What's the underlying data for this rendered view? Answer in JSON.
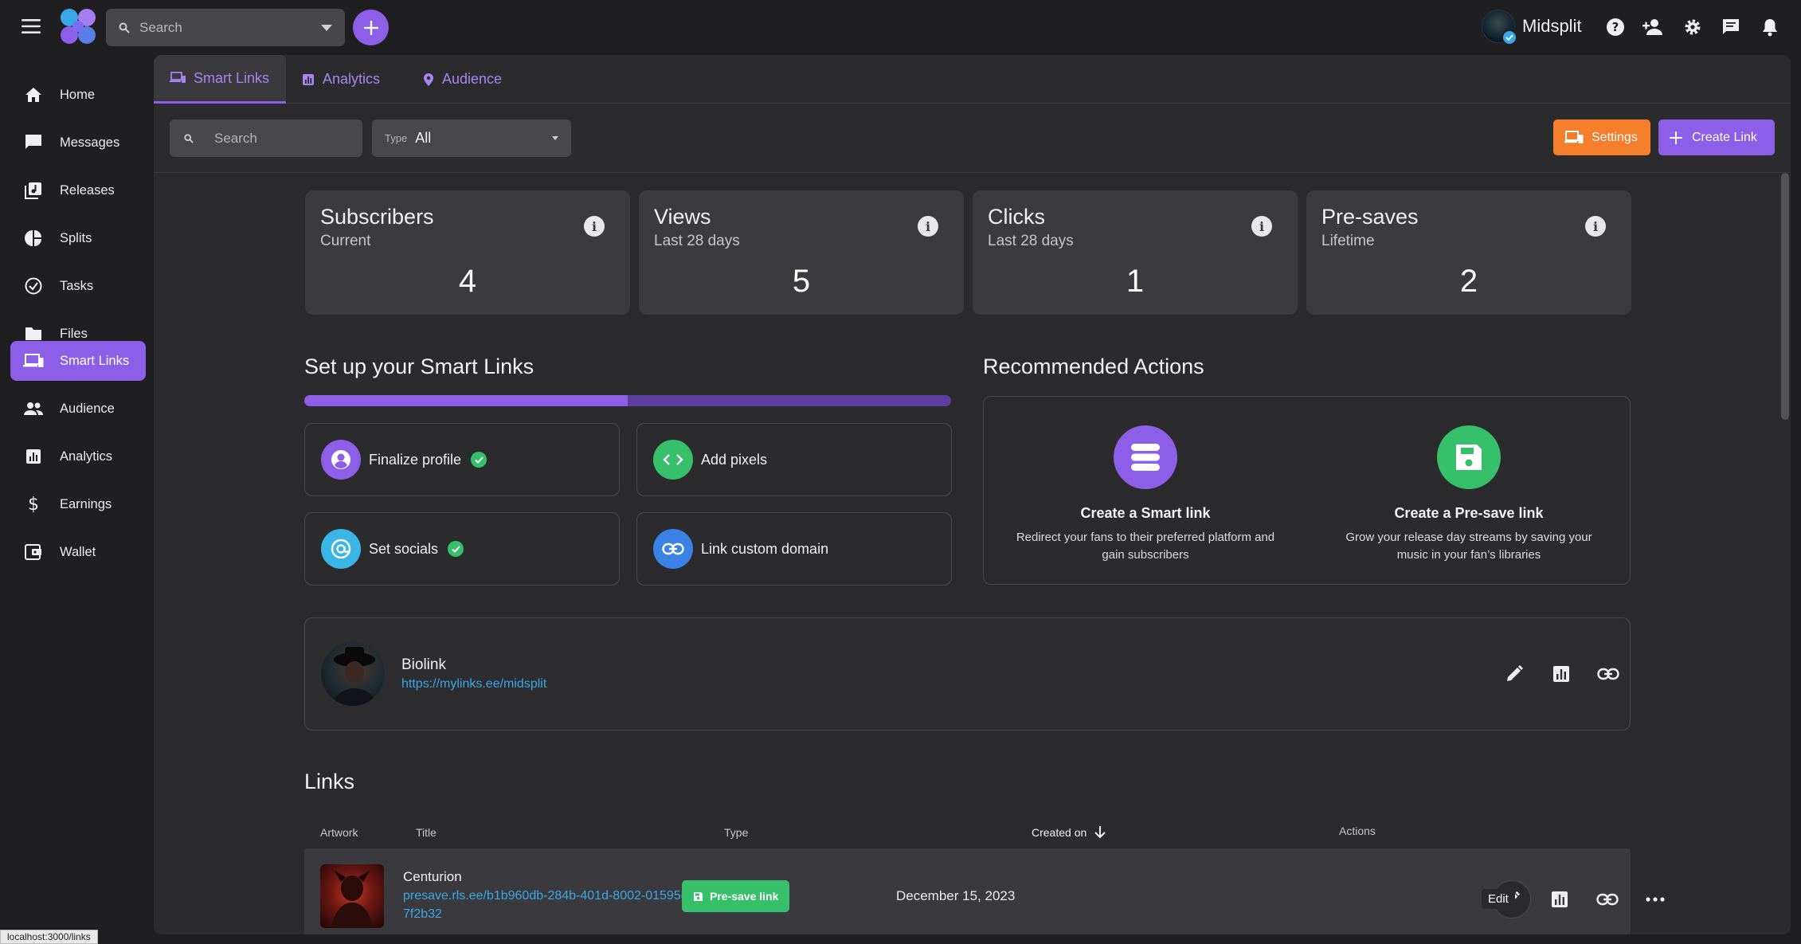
{
  "topbar": {
    "search_placeholder": "Search",
    "account_name": "Midsplit"
  },
  "sidebar": {
    "items": [
      {
        "label": "Home",
        "icon": "home-icon"
      },
      {
        "label": "Messages",
        "icon": "message-icon"
      },
      {
        "label": "Releases",
        "icon": "releases-icon"
      },
      {
        "label": "Splits",
        "icon": "pie-chart-icon"
      },
      {
        "label": "Tasks",
        "icon": "check-circle-icon"
      },
      {
        "label": "Files",
        "icon": "folder-icon"
      },
      {
        "label": "Smart Links",
        "icon": "devices-icon",
        "active": true
      },
      {
        "label": "Audience",
        "icon": "people-icon"
      },
      {
        "label": "Analytics",
        "icon": "bar-chart-icon"
      },
      {
        "label": "Earnings",
        "icon": "dollar-icon"
      },
      {
        "label": "Wallet",
        "icon": "wallet-icon"
      }
    ]
  },
  "tabs": [
    {
      "label": "Smart Links",
      "active": true
    },
    {
      "label": "Analytics"
    },
    {
      "label": "Audience"
    }
  ],
  "filters": {
    "search_placeholder": "Search",
    "type_label": "Type",
    "type_value": "All"
  },
  "actions": {
    "settings_label": "Settings",
    "create_link_label": "Create Link"
  },
  "stats": [
    {
      "title": "Subscribers",
      "subtitle": "Current",
      "value": "4"
    },
    {
      "title": "Views",
      "subtitle": "Last 28 days",
      "value": "5"
    },
    {
      "title": "Clicks",
      "subtitle": "Last 28 days",
      "value": "1"
    },
    {
      "title": "Pre-saves",
      "subtitle": "Lifetime",
      "value": "2"
    }
  ],
  "setup": {
    "title": "Set up your Smart Links",
    "progress": 0.5,
    "items": [
      {
        "label": "Finalize profile",
        "done": true,
        "color": "#8d5ee8"
      },
      {
        "label": "Add pixels",
        "done": false,
        "color": "#37c06a"
      },
      {
        "label": "Set socials",
        "done": true,
        "color": "#3ab6e6"
      },
      {
        "label": "Link custom domain",
        "done": false,
        "color": "#3a82e6"
      }
    ]
  },
  "recommended": {
    "title": "Recommended Actions",
    "items": [
      {
        "title": "Create a Smart link",
        "desc": "Redirect your fans to their preferred platform and gain subscribers",
        "color": "#8d5ee8"
      },
      {
        "title": "Create a Pre-save link",
        "desc": "Grow your release day streams by saving your music in your fan’s libraries",
        "color": "#37c06a"
      }
    ]
  },
  "biolink": {
    "title": "Biolink",
    "url": "https://mylinks.ee/midsplit"
  },
  "links": {
    "title": "Links",
    "columns": [
      "Artwork",
      "Title",
      "Type",
      "Created on",
      "Actions"
    ],
    "rows": [
      {
        "title": "Centurion",
        "url": "presave.rls.ee/b1b960db-284b-401d-8002-01595c7f2b32",
        "type": "Pre-save link",
        "created": "December 15, 2023"
      }
    ],
    "tooltip": "Edit"
  },
  "status_url": "localhost:3000/links",
  "colors": {
    "accent": "#8d5ee8",
    "settings": "#f47e2a",
    "success": "#37c06a",
    "link": "#3aa7e6"
  }
}
